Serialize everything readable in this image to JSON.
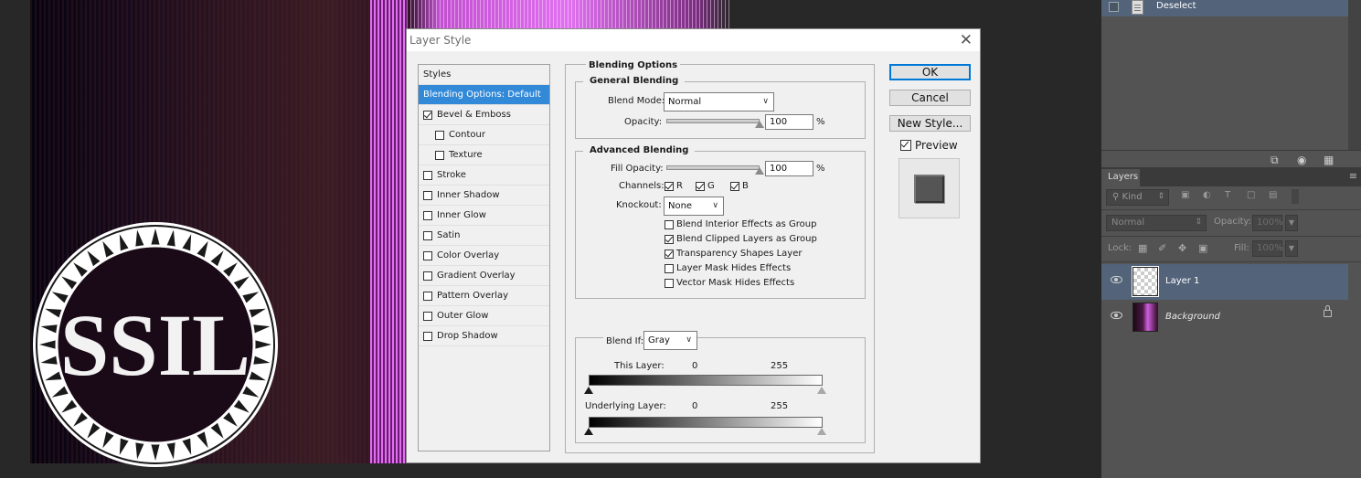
{
  "logo_text": "SSIL",
  "dialog": {
    "title": "Layer Style",
    "styles_header": "Styles",
    "styles": [
      {
        "label": "Blending Options: Default",
        "selected": true,
        "checkbox": false
      },
      {
        "label": "Bevel & Emboss",
        "checked": true,
        "checkbox": true
      },
      {
        "label": "Contour",
        "checked": false,
        "checkbox": true,
        "indent": true
      },
      {
        "label": "Texture",
        "checked": false,
        "checkbox": true,
        "indent": true
      },
      {
        "label": "Stroke",
        "checked": false,
        "checkbox": true
      },
      {
        "label": "Inner Shadow",
        "checked": false,
        "checkbox": true
      },
      {
        "label": "Inner Glow",
        "checked": false,
        "checkbox": true
      },
      {
        "label": "Satin",
        "checked": false,
        "checkbox": true
      },
      {
        "label": "Color Overlay",
        "checked": false,
        "checkbox": true
      },
      {
        "label": "Gradient Overlay",
        "checked": false,
        "checkbox": true
      },
      {
        "label": "Pattern Overlay",
        "checked": false,
        "checkbox": true
      },
      {
        "label": "Outer Glow",
        "checked": false,
        "checkbox": true
      },
      {
        "label": "Drop Shadow",
        "checked": false,
        "checkbox": true
      }
    ],
    "blending_options_title": "Blending Options",
    "general": {
      "title": "General Blending",
      "blend_mode_label": "Blend Mode:",
      "blend_mode_value": "Normal",
      "opacity_label": "Opacity:",
      "opacity_value": "100",
      "opacity_fraction": 1.0,
      "percent": "%"
    },
    "advanced": {
      "title": "Advanced Blending",
      "fill_opacity_label": "Fill Opacity:",
      "fill_opacity_value": "100",
      "fill_opacity_fraction": 1.0,
      "percent": "%",
      "channels_label": "Channels:",
      "channel_r": "R",
      "channel_g": "G",
      "channel_b": "B",
      "knockout_label": "Knockout:",
      "knockout_value": "None",
      "options": [
        {
          "label": "Blend Interior Effects as Group",
          "checked": false
        },
        {
          "label": "Blend Clipped Layers as Group",
          "checked": true
        },
        {
          "label": "Transparency Shapes Layer",
          "checked": true
        },
        {
          "label": "Layer Mask Hides Effects",
          "checked": false
        },
        {
          "label": "Vector Mask Hides Effects",
          "checked": false
        }
      ]
    },
    "blend_if": {
      "label": "Blend If:",
      "value": "Gray",
      "this_layer_label": "This Layer:",
      "underlying_label": "Underlying Layer:",
      "low": "0",
      "high": "255"
    },
    "buttons": {
      "ok": "OK",
      "cancel": "Cancel",
      "new_style": "New Style...",
      "preview_label": "Preview",
      "preview_checked": true
    }
  },
  "history": {
    "item": "Deselect"
  },
  "layers": {
    "tab": "Layers",
    "kind": "Kind",
    "blend_mode": "Normal",
    "opacity_label": "Opacity:",
    "opacity_value": "100%",
    "lock_label": "Lock:",
    "fill_label": "Fill:",
    "fill_value": "100%",
    "items": [
      {
        "name": "Layer 1",
        "active": true
      },
      {
        "name": "Background",
        "active": false,
        "locked": true
      }
    ]
  },
  "colors": {
    "selection_blue": "#3189d8",
    "layer_active": "#53637a",
    "panel_bg": "#535353",
    "accent_pink": "#e070f0"
  }
}
